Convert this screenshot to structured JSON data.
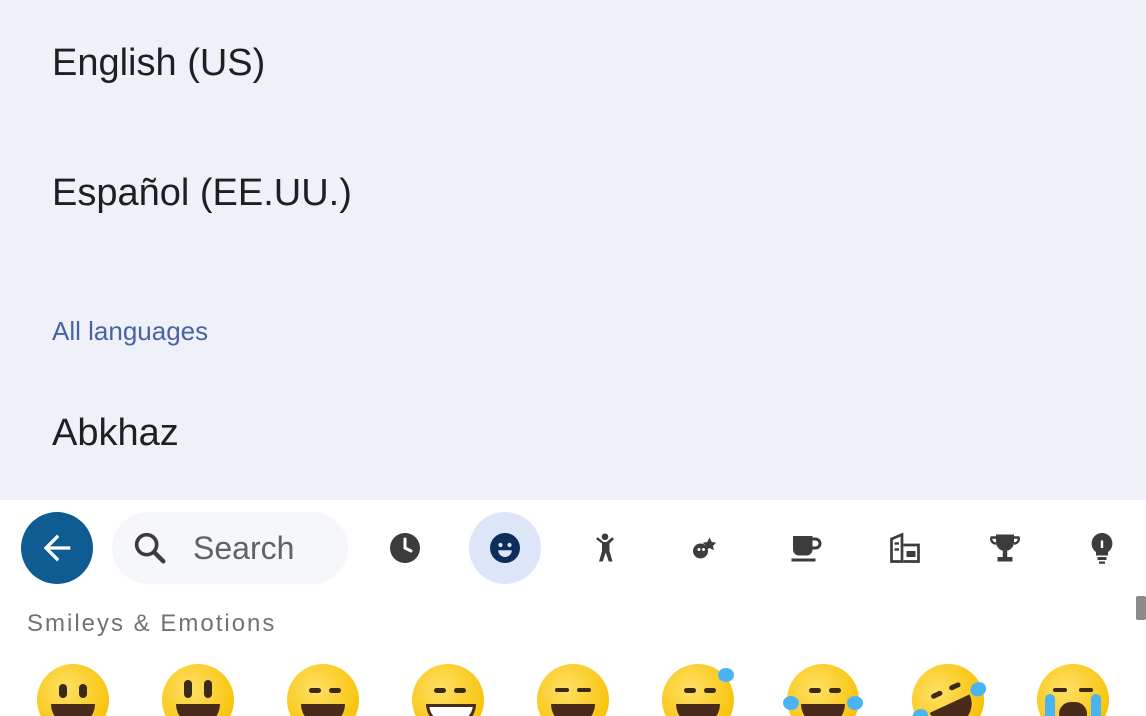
{
  "languages": {
    "items": [
      "English (US)",
      "Español (EE.UU.)"
    ],
    "section_header": "All languages",
    "first_all": "Abkhaz"
  },
  "keyboard": {
    "search_placeholder": "Search",
    "section_title": "Smileys & Emotions",
    "categories": [
      "recent-icon",
      "smileys-icon",
      "people-icon",
      "animals-nature-icon",
      "food-drink-icon",
      "travel-places-icon",
      "activities-icon",
      "objects-icon"
    ],
    "selected_category": "smileys-icon",
    "accent_color": "#0f5c93",
    "emojis": [
      "grinning-face",
      "grinning-face-big-eyes",
      "grinning-face-smiling-eyes",
      "beaming-face",
      "squinting-face",
      "sweat-smile-face",
      "tears-of-joy-face",
      "rolling-on-floor-laughing-face",
      "loudly-crying-face"
    ]
  }
}
